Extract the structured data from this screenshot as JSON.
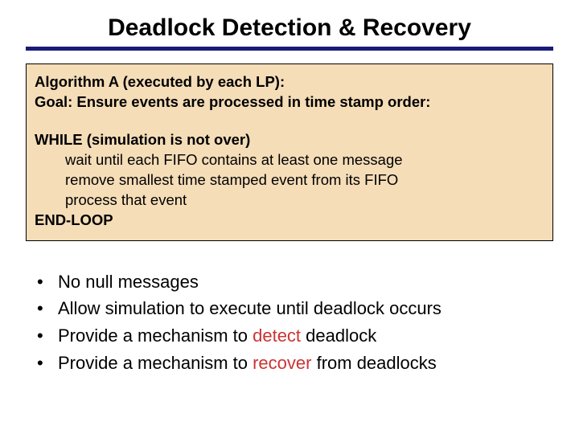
{
  "title": "Deadlock Detection & Recovery",
  "algo": {
    "header1": "Algorithm A (executed by each LP):",
    "header2": "Goal: Ensure events are processed in time stamp order:",
    "while": "WHILE (simulation is not over)",
    "l1": "wait until each FIFO contains at least one message",
    "l2": "remove smallest time stamped event from its FIFO",
    "l3": "process that event",
    "end": "END-LOOP"
  },
  "bullets": {
    "b1": "No null messages",
    "b2": "Allow simulation to execute until deadlock occurs",
    "b3_pre": "Provide a mechanism to ",
    "b3_hl": "detect",
    "b3_post": " deadlock",
    "b4_pre": "Provide a mechanism to ",
    "b4_hl": "recover",
    "b4_post": " from deadlocks"
  }
}
